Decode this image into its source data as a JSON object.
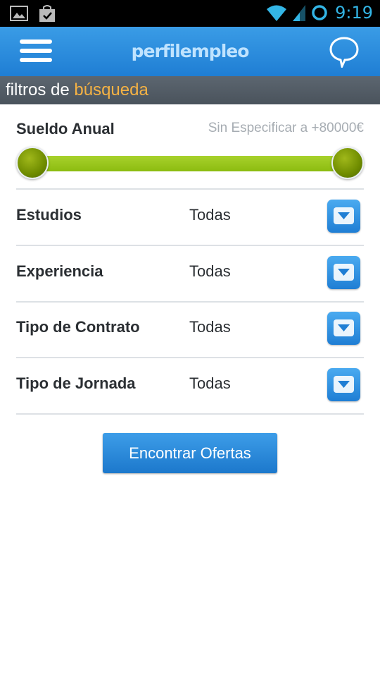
{
  "status_bar": {
    "time": "9:19",
    "icons_left": [
      "image-icon",
      "shopping-bag-icon"
    ],
    "icons_right": [
      "wifi-icon",
      "signal-icon",
      "sync-circle-icon"
    ],
    "accent_color": "#33b5e5"
  },
  "app_bar": {
    "logo": "perfilempleo",
    "menu_icon": "hamburger-menu-icon",
    "chat_icon": "chat-bubble-icon",
    "color": "#2a8be0"
  },
  "section": {
    "title_prefix": "filtros de",
    "title_accent": "búsqueda",
    "accent_color": "#f5b244"
  },
  "salary": {
    "label": "Sueldo Anual",
    "range_text": "Sin Especificar a +80000€",
    "slider_min_fraction": 0.0,
    "slider_max_fraction": 1.0,
    "track_color": "#9cc81e"
  },
  "filters": [
    {
      "label": "Estudios",
      "value": "Todas"
    },
    {
      "label": "Experiencia",
      "value": "Todas"
    },
    {
      "label": "Tipo de Contrato",
      "value": "Todas"
    },
    {
      "label": "Tipo de Jornada",
      "value": "Todas"
    }
  ],
  "find_button": {
    "label": "Encontrar Ofertas"
  }
}
